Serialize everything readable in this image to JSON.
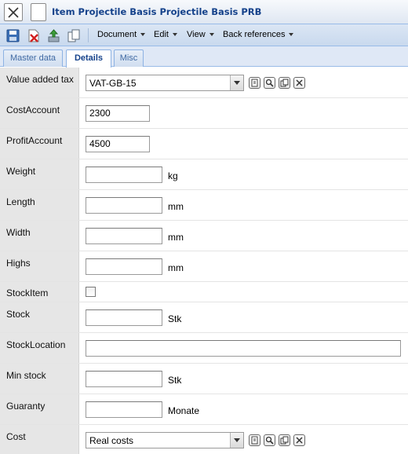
{
  "window": {
    "title": "Item Projectile Basis Projectile Basis PRB"
  },
  "toolbar": {
    "icons": [
      "save-icon",
      "delete-icon",
      "export-icon",
      "copy-icon"
    ],
    "menus": [
      {
        "label": "Document"
      },
      {
        "label": "Edit"
      },
      {
        "label": "View"
      },
      {
        "label": "Back references"
      }
    ]
  },
  "tabs": [
    {
      "label": "Master data",
      "active": false
    },
    {
      "label": "Details",
      "active": true
    },
    {
      "label": "Misc",
      "active": false
    }
  ],
  "form": {
    "vat": {
      "label": "Value added tax",
      "value": "VAT-GB-15"
    },
    "cost_account": {
      "label": "CostAccount",
      "value": "2300"
    },
    "profit_account": {
      "label": "ProfitAccount",
      "value": "4500"
    },
    "weight": {
      "label": "Weight",
      "value": "",
      "unit": "kg"
    },
    "length": {
      "label": "Length",
      "value": "",
      "unit": "mm"
    },
    "width": {
      "label": "Width",
      "value": "",
      "unit": "mm"
    },
    "highs": {
      "label": "Highs",
      "value": "",
      "unit": "mm"
    },
    "stock_item": {
      "label": "StockItem",
      "checked": false
    },
    "stock": {
      "label": "Stock",
      "value": "",
      "unit": "Stk"
    },
    "stock_location": {
      "label": "StockLocation",
      "value": ""
    },
    "min_stock": {
      "label": "Min stock",
      "value": "",
      "unit": "Stk"
    },
    "guaranty": {
      "label": "Guaranty",
      "value": "",
      "unit": "Monate"
    },
    "cost": {
      "label": "Cost",
      "value": "Real costs"
    }
  },
  "colors": {
    "title": "#15428b",
    "tab_active": "#15428b",
    "label_bg": "#e6e6e6"
  }
}
